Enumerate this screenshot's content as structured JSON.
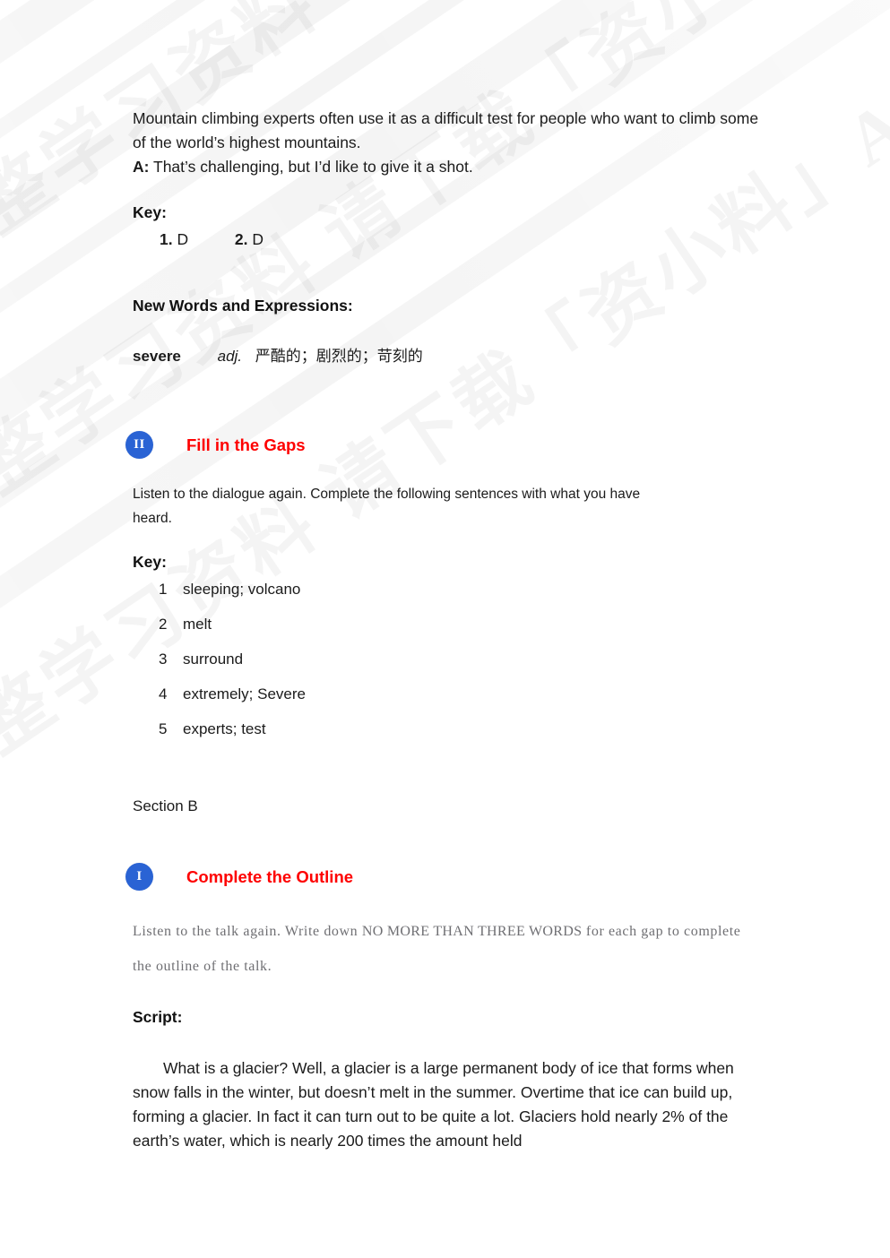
{
  "watermark": {
    "text": "免费查看完整学习资料 请下载「资小料」APP"
  },
  "colors": {
    "badge_blue": "#2a63d4",
    "heading_red": "#fe0000",
    "body_text": "#1b1b1b",
    "mono_text": "#6f6f73"
  },
  "dialogue": {
    "line1": "Mountain climbing experts often use it as a difficult test for people who want to climb some of the world’s highest mountains.",
    "speaker_a_label": "A:",
    "speaker_a_text": " That’s challenging, but I’d like to give it a shot."
  },
  "key_section_1": {
    "heading": "Key:",
    "answers": [
      {
        "num": "1.",
        "value": "D"
      },
      {
        "num": "2.",
        "value": "D"
      }
    ]
  },
  "new_words": {
    "heading": "New Words and Expressions:",
    "entries": [
      {
        "word": "severe",
        "pos": "adj.",
        "definition": "严酷的；剧烈的；苛刻的"
      }
    ]
  },
  "activity_fill_gaps": {
    "badge": "II",
    "title": "Fill in the Gaps",
    "instruction": "Listen to the dialogue again. Complete the following sentences with what you have heard.",
    "key_heading": "Key:",
    "answers": [
      {
        "num": "1",
        "text": "sleeping; volcano"
      },
      {
        "num": "2",
        "text": "melt"
      },
      {
        "num": "3",
        "text": "surround"
      },
      {
        "num": "4",
        "text": "extremely; Severe"
      },
      {
        "num": "5",
        "text": "experts; test"
      }
    ]
  },
  "section_b": {
    "label": "Section B",
    "badge": "I",
    "title": "Complete the Outline",
    "instruction_pre": "Listen to the talk again. Write down ",
    "instruction_caps": "NO MORE THAN THREE WORDS",
    "instruction_post": " for each gap to complete the outline of the talk.",
    "script_heading": "Script:",
    "script_text": "What is a glacier? Well, a glacier is a large permanent body of ice that forms when snow falls in the winter, but doesn’t melt in the summer. Overtime that ice can build up, forming a glacier. In fact it can turn out to be quite a lot. Glaciers hold nearly 2% of the earth’s water, which is nearly 200 times the amount held"
  }
}
